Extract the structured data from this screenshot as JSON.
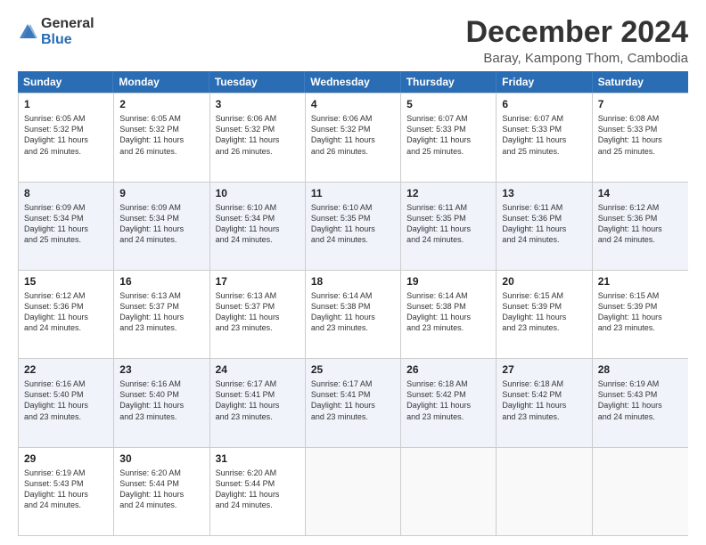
{
  "logo": {
    "line1": "General",
    "line2": "Blue"
  },
  "title": "December 2024",
  "subtitle": "Baray, Kampong Thom, Cambodia",
  "headers": [
    "Sunday",
    "Monday",
    "Tuesday",
    "Wednesday",
    "Thursday",
    "Friday",
    "Saturday"
  ],
  "weeks": [
    [
      {
        "day": "1",
        "lines": [
          "Sunrise: 6:05 AM",
          "Sunset: 5:32 PM",
          "Daylight: 11 hours",
          "and 26 minutes."
        ]
      },
      {
        "day": "2",
        "lines": [
          "Sunrise: 6:05 AM",
          "Sunset: 5:32 PM",
          "Daylight: 11 hours",
          "and 26 minutes."
        ]
      },
      {
        "day": "3",
        "lines": [
          "Sunrise: 6:06 AM",
          "Sunset: 5:32 PM",
          "Daylight: 11 hours",
          "and 26 minutes."
        ]
      },
      {
        "day": "4",
        "lines": [
          "Sunrise: 6:06 AM",
          "Sunset: 5:32 PM",
          "Daylight: 11 hours",
          "and 26 minutes."
        ]
      },
      {
        "day": "5",
        "lines": [
          "Sunrise: 6:07 AM",
          "Sunset: 5:33 PM",
          "Daylight: 11 hours",
          "and 25 minutes."
        ]
      },
      {
        "day": "6",
        "lines": [
          "Sunrise: 6:07 AM",
          "Sunset: 5:33 PM",
          "Daylight: 11 hours",
          "and 25 minutes."
        ]
      },
      {
        "day": "7",
        "lines": [
          "Sunrise: 6:08 AM",
          "Sunset: 5:33 PM",
          "Daylight: 11 hours",
          "and 25 minutes."
        ]
      }
    ],
    [
      {
        "day": "8",
        "lines": [
          "Sunrise: 6:09 AM",
          "Sunset: 5:34 PM",
          "Daylight: 11 hours",
          "and 25 minutes."
        ]
      },
      {
        "day": "9",
        "lines": [
          "Sunrise: 6:09 AM",
          "Sunset: 5:34 PM",
          "Daylight: 11 hours",
          "and 24 minutes."
        ]
      },
      {
        "day": "10",
        "lines": [
          "Sunrise: 6:10 AM",
          "Sunset: 5:34 PM",
          "Daylight: 11 hours",
          "and 24 minutes."
        ]
      },
      {
        "day": "11",
        "lines": [
          "Sunrise: 6:10 AM",
          "Sunset: 5:35 PM",
          "Daylight: 11 hours",
          "and 24 minutes."
        ]
      },
      {
        "day": "12",
        "lines": [
          "Sunrise: 6:11 AM",
          "Sunset: 5:35 PM",
          "Daylight: 11 hours",
          "and 24 minutes."
        ]
      },
      {
        "day": "13",
        "lines": [
          "Sunrise: 6:11 AM",
          "Sunset: 5:36 PM",
          "Daylight: 11 hours",
          "and 24 minutes."
        ]
      },
      {
        "day": "14",
        "lines": [
          "Sunrise: 6:12 AM",
          "Sunset: 5:36 PM",
          "Daylight: 11 hours",
          "and 24 minutes."
        ]
      }
    ],
    [
      {
        "day": "15",
        "lines": [
          "Sunrise: 6:12 AM",
          "Sunset: 5:36 PM",
          "Daylight: 11 hours",
          "and 24 minutes."
        ]
      },
      {
        "day": "16",
        "lines": [
          "Sunrise: 6:13 AM",
          "Sunset: 5:37 PM",
          "Daylight: 11 hours",
          "and 23 minutes."
        ]
      },
      {
        "day": "17",
        "lines": [
          "Sunrise: 6:13 AM",
          "Sunset: 5:37 PM",
          "Daylight: 11 hours",
          "and 23 minutes."
        ]
      },
      {
        "day": "18",
        "lines": [
          "Sunrise: 6:14 AM",
          "Sunset: 5:38 PM",
          "Daylight: 11 hours",
          "and 23 minutes."
        ]
      },
      {
        "day": "19",
        "lines": [
          "Sunrise: 6:14 AM",
          "Sunset: 5:38 PM",
          "Daylight: 11 hours",
          "and 23 minutes."
        ]
      },
      {
        "day": "20",
        "lines": [
          "Sunrise: 6:15 AM",
          "Sunset: 5:39 PM",
          "Daylight: 11 hours",
          "and 23 minutes."
        ]
      },
      {
        "day": "21",
        "lines": [
          "Sunrise: 6:15 AM",
          "Sunset: 5:39 PM",
          "Daylight: 11 hours",
          "and 23 minutes."
        ]
      }
    ],
    [
      {
        "day": "22",
        "lines": [
          "Sunrise: 6:16 AM",
          "Sunset: 5:40 PM",
          "Daylight: 11 hours",
          "and 23 minutes."
        ]
      },
      {
        "day": "23",
        "lines": [
          "Sunrise: 6:16 AM",
          "Sunset: 5:40 PM",
          "Daylight: 11 hours",
          "and 23 minutes."
        ]
      },
      {
        "day": "24",
        "lines": [
          "Sunrise: 6:17 AM",
          "Sunset: 5:41 PM",
          "Daylight: 11 hours",
          "and 23 minutes."
        ]
      },
      {
        "day": "25",
        "lines": [
          "Sunrise: 6:17 AM",
          "Sunset: 5:41 PM",
          "Daylight: 11 hours",
          "and 23 minutes."
        ]
      },
      {
        "day": "26",
        "lines": [
          "Sunrise: 6:18 AM",
          "Sunset: 5:42 PM",
          "Daylight: 11 hours",
          "and 23 minutes."
        ]
      },
      {
        "day": "27",
        "lines": [
          "Sunrise: 6:18 AM",
          "Sunset: 5:42 PM",
          "Daylight: 11 hours",
          "and 23 minutes."
        ]
      },
      {
        "day": "28",
        "lines": [
          "Sunrise: 6:19 AM",
          "Sunset: 5:43 PM",
          "Daylight: 11 hours",
          "and 24 minutes."
        ]
      }
    ],
    [
      {
        "day": "29",
        "lines": [
          "Sunrise: 6:19 AM",
          "Sunset: 5:43 PM",
          "Daylight: 11 hours",
          "and 24 minutes."
        ]
      },
      {
        "day": "30",
        "lines": [
          "Sunrise: 6:20 AM",
          "Sunset: 5:44 PM",
          "Daylight: 11 hours",
          "and 24 minutes."
        ]
      },
      {
        "day": "31",
        "lines": [
          "Sunrise: 6:20 AM",
          "Sunset: 5:44 PM",
          "Daylight: 11 hours",
          "and 24 minutes."
        ]
      },
      {
        "day": "",
        "lines": []
      },
      {
        "day": "",
        "lines": []
      },
      {
        "day": "",
        "lines": []
      },
      {
        "day": "",
        "lines": []
      }
    ]
  ],
  "alt_rows": [
    1,
    3
  ]
}
